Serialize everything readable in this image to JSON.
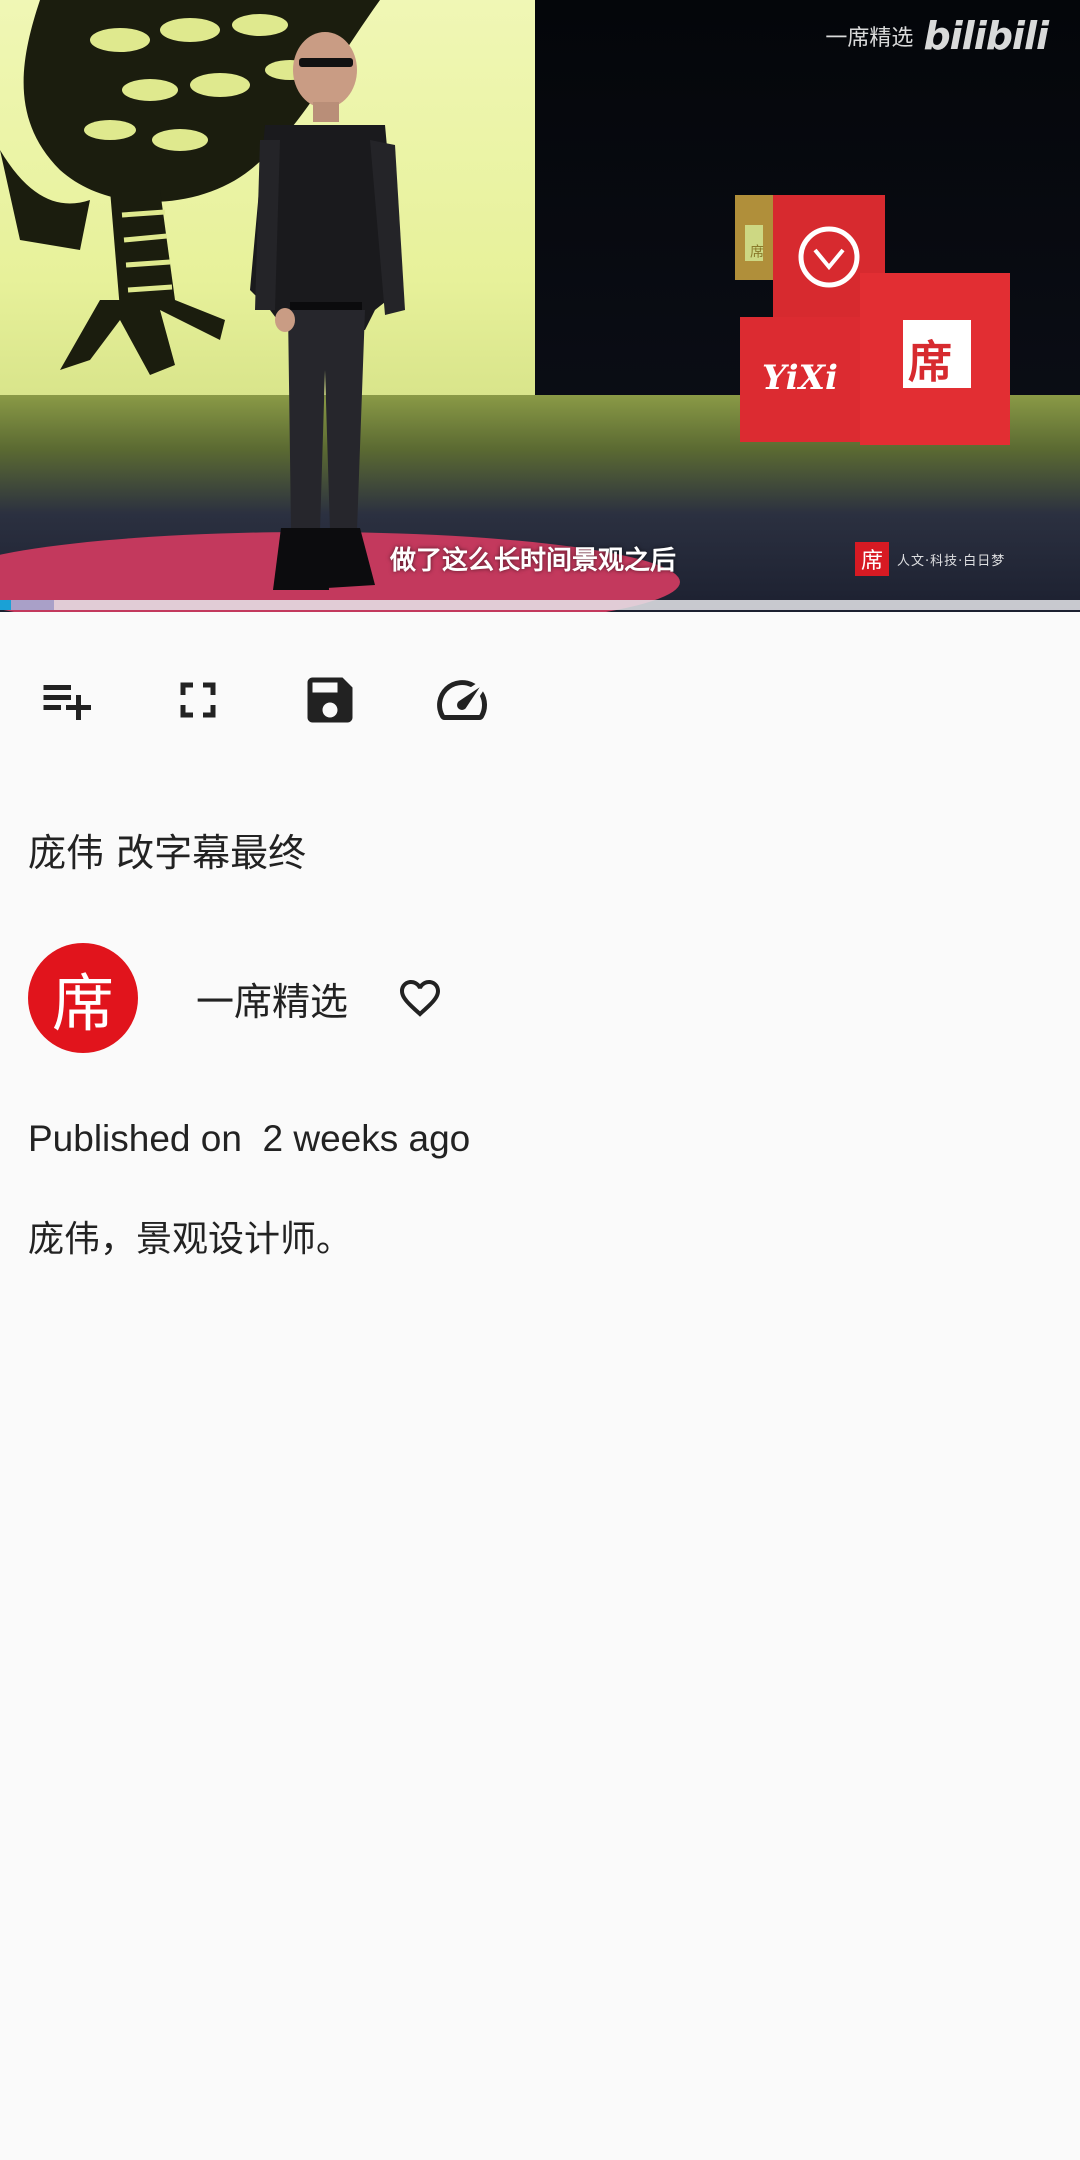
{
  "video": {
    "watermark_channel": "一席精选",
    "watermark_brand": "bilibili",
    "subtitle": "做了这么长时间景观之后",
    "box_brand_text": "YiXi",
    "box_seal_char": "席",
    "box_side_label": "席",
    "corner_logo_char": "席",
    "corner_logo_text": "人文·科技·白日梦",
    "progress": 0.01,
    "buffered": 0.05
  },
  "controls": [
    {
      "name": "add-to-playlist-button",
      "icon": "playlist-add-icon"
    },
    {
      "name": "fullscreen-button",
      "icon": "fullscreen-icon"
    },
    {
      "name": "save-button",
      "icon": "save-icon"
    },
    {
      "name": "playback-speed-button",
      "icon": "speed-icon"
    }
  ],
  "video_info": {
    "title": "庞伟 改字幕最终",
    "channel": {
      "avatar_char": "席",
      "name": "一席精选"
    },
    "published_label": "Published on",
    "published_value": "2 weeks ago",
    "description": "庞伟，景观设计师。"
  },
  "colors": {
    "accent_progress": "#1aa1d6",
    "avatar_red": "#e1141c",
    "background": "#fafafa"
  }
}
